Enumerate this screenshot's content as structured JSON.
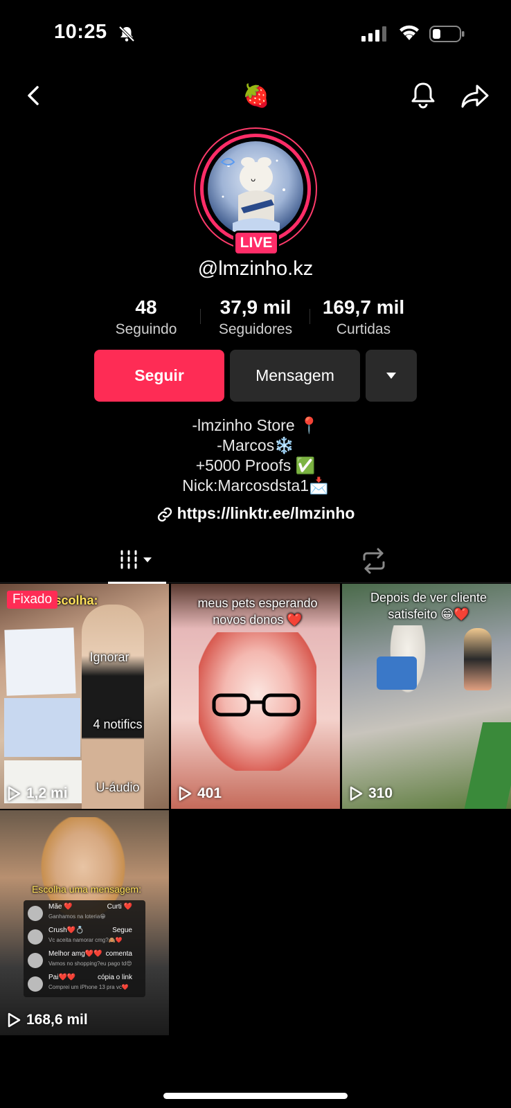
{
  "status_bar": {
    "time": "10:25"
  },
  "header": {
    "title_emoji": "🍓"
  },
  "profile": {
    "live_label": "LIVE",
    "username": "@lmzinho.kz"
  },
  "stats": [
    {
      "value": "48",
      "label": "Seguindo"
    },
    {
      "value": "37,9 mil",
      "label": "Seguidores"
    },
    {
      "value": "169,7 mil",
      "label": "Curtidas"
    }
  ],
  "actions": {
    "follow": "Seguir",
    "message": "Mensagem"
  },
  "bio": {
    "lines": [
      "-lmzinho Store 📍",
      "-Marcos❄️",
      "+5000 Proofs ✅",
      "Nick:Marcosdsta1📩"
    ],
    "link": "https://linktr.ee/lmzinho"
  },
  "videos": [
    {
      "pinned_label": "Fixado",
      "views": "1,2 mi",
      "overlay_texts": [
        "Escolha:",
        "Ignorar",
        "4 notifics",
        "U-áudio"
      ]
    },
    {
      "views": "401",
      "caption": "meus pets esperando novos donos ❤️"
    },
    {
      "views": "310",
      "caption": "Depois de ver cliente satisfeito 😁❤️"
    },
    {
      "views": "168,6 mil",
      "caption": "Escolha uma mensagem:",
      "chat": [
        {
          "name": "Mãe ❤️",
          "msg": "Ganhamos na loteria😁",
          "action": "Curti ❤️"
        },
        {
          "name": "Crush❤️💍",
          "msg": "Vc aceita namorar cmg?🙈❤️",
          "action": "Segue"
        },
        {
          "name": "Melhor amg❤️❤️",
          "msg": "Vamos no shopping?eu pago td😍",
          "action": "comenta"
        },
        {
          "name": "Pai❤️❤️",
          "msg": "Comprei um iPhone 13 pra vc❤️",
          "action": "cópia o link"
        }
      ]
    }
  ],
  "colors": {
    "accent": "#fe2c55",
    "button_dark": "#2a2a2a",
    "background": "#000000"
  }
}
